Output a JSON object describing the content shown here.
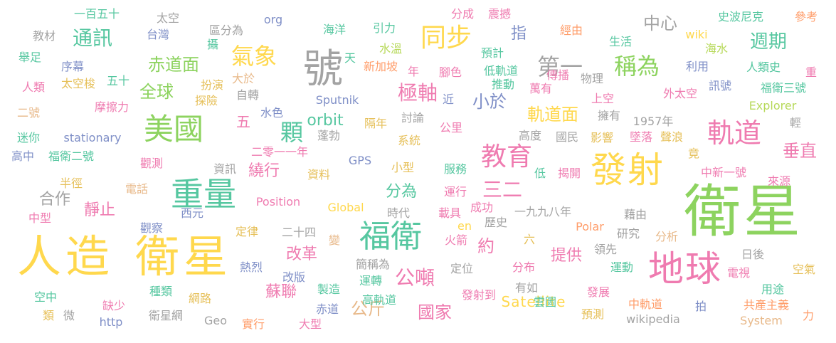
{
  "palette": {
    "yellow": "#ffd84d",
    "green": "#8dd35f",
    "teal": "#56c7a0",
    "pink": "#ef7bb0",
    "orange": "#ff9d6a",
    "gold": "#e6c05a",
    "gray": "#a3a3a3",
    "blue": "#7f8fc7",
    "tan": "#e8b98a",
    "lime": "#b7d95a"
  },
  "words": [
    {
      "text": "衛星",
      "color": "green"
    },
    {
      "text": "人造",
      "color": "yellow"
    },
    {
      "text": "衛星",
      "color": "yellow"
    },
    {
      "text": "地球",
      "color": "pink"
    },
    {
      "text": "發射",
      "color": "yellow"
    },
    {
      "text": "號",
      "color": "gray"
    },
    {
      "text": "重量",
      "color": "teal"
    },
    {
      "text": "福衛",
      "color": "teal"
    },
    {
      "text": "美國",
      "color": "green"
    },
    {
      "text": "同步",
      "color": "yellow"
    },
    {
      "text": "教育",
      "color": "pink"
    },
    {
      "text": "軌道",
      "color": "pink"
    },
    {
      "text": "氣象",
      "color": "yellow"
    },
    {
      "text": "稱為",
      "color": "green"
    },
    {
      "text": "第一",
      "color": "gray"
    },
    {
      "text": "顆",
      "color": "teal"
    },
    {
      "text": "三二",
      "color": "pink"
    },
    {
      "text": "通訊",
      "color": "teal"
    },
    {
      "text": "極軸",
      "color": "pink"
    },
    {
      "text": "公噸",
      "color": "pink"
    },
    {
      "text": "週期",
      "color": "teal"
    },
    {
      "text": "赤道面",
      "color": "green"
    },
    {
      "text": "全球",
      "color": "green"
    },
    {
      "text": "軌道面",
      "color": "yellow"
    },
    {
      "text": "垂直",
      "color": "pink"
    },
    {
      "text": "小於",
      "color": "blue"
    },
    {
      "text": "約",
      "color": "pink"
    },
    {
      "text": "中心",
      "color": "gray"
    },
    {
      "text": "國家",
      "color": "pink"
    },
    {
      "text": "公斤",
      "color": "tan"
    },
    {
      "text": "蘇聯",
      "color": "pink"
    },
    {
      "text": "改革",
      "color": "pink"
    },
    {
      "text": "提供",
      "color": "pink"
    },
    {
      "text": "分為",
      "color": "teal"
    },
    {
      "text": "繞行",
      "color": "pink"
    },
    {
      "text": "靜止",
      "color": "pink"
    },
    {
      "text": "指",
      "color": "blue"
    },
    {
      "text": "五",
      "color": "pink"
    },
    {
      "text": "合作",
      "color": "gray"
    },
    {
      "text": "orbit",
      "color": "teal"
    },
    {
      "text": "Satellite",
      "color": "yellow"
    },
    {
      "text": "Explorer",
      "color": "lime"
    },
    {
      "text": "Sputnik",
      "color": "blue"
    },
    {
      "text": "stationary",
      "color": "blue"
    },
    {
      "text": "GPS",
      "color": "blue"
    },
    {
      "text": "Position",
      "color": "pink"
    },
    {
      "text": "Global",
      "color": "yellow"
    },
    {
      "text": "Polar",
      "color": "orange"
    },
    {
      "text": "en",
      "color": "yellow"
    },
    {
      "text": "org",
      "color": "blue"
    },
    {
      "text": "wiki",
      "color": "yellow"
    },
    {
      "text": "http",
      "color": "blue"
    },
    {
      "text": "Geo",
      "color": "gray"
    },
    {
      "text": "wikipedia",
      "color": "gray"
    },
    {
      "text": "System",
      "color": "tan"
    },
    {
      "text": "一百五十",
      "color": "teal"
    },
    {
      "text": "太空",
      "color": "gray"
    },
    {
      "text": "台灣",
      "color": "blue"
    },
    {
      "text": "區分為",
      "color": "gray"
    },
    {
      "text": "海洋",
      "color": "teal"
    },
    {
      "text": "引力",
      "color": "teal"
    },
    {
      "text": "分成",
      "color": "pink"
    },
    {
      "text": "震撼",
      "color": "pink"
    },
    {
      "text": "經由",
      "color": "orange"
    },
    {
      "text": "史波尼克",
      "color": "teal"
    },
    {
      "text": "參考",
      "color": "orange"
    },
    {
      "text": "教材",
      "color": "gray"
    },
    {
      "text": "攝",
      "color": "teal"
    },
    {
      "text": "水溫",
      "color": "lime"
    },
    {
      "text": "預計",
      "color": "teal"
    },
    {
      "text": "生活",
      "color": "teal"
    },
    {
      "text": "海水",
      "color": "lime"
    },
    {
      "text": "舉足",
      "color": "teal"
    },
    {
      "text": "序幕",
      "color": "blue"
    },
    {
      "text": "大於",
      "color": "tan"
    },
    {
      "text": "天",
      "color": "teal"
    },
    {
      "text": "新加坡",
      "color": "orange"
    },
    {
      "text": "年",
      "color": "pink"
    },
    {
      "text": "腳色",
      "color": "pink"
    },
    {
      "text": "低軌道",
      "color": "teal"
    },
    {
      "text": "傳播",
      "color": "pink"
    },
    {
      "text": "利用",
      "color": "blue"
    },
    {
      "text": "人類史",
      "color": "teal"
    },
    {
      "text": "重",
      "color": "pink"
    },
    {
      "text": "人類",
      "color": "pink"
    },
    {
      "text": "太空梭",
      "color": "gold"
    },
    {
      "text": "五十",
      "color": "teal"
    },
    {
      "text": "扮演",
      "color": "gold"
    },
    {
      "text": "推動",
      "color": "teal"
    },
    {
      "text": "萬有",
      "color": "pink"
    },
    {
      "text": "物理",
      "color": "gray"
    },
    {
      "text": "訊號",
      "color": "blue"
    },
    {
      "text": "福衛三號",
      "color": "teal"
    },
    {
      "text": "二號",
      "color": "tan"
    },
    {
      "text": "摩擦力",
      "color": "pink"
    },
    {
      "text": "探險",
      "color": "gold"
    },
    {
      "text": "自轉",
      "color": "gray"
    },
    {
      "text": "近",
      "color": "blue"
    },
    {
      "text": "上空",
      "color": "pink"
    },
    {
      "text": "外太空",
      "color": "pink"
    },
    {
      "text": "水色",
      "color": "blue"
    },
    {
      "text": "討論",
      "color": "gray"
    },
    {
      "text": "擁有",
      "color": "gray"
    },
    {
      "text": "1957年",
      "color": "gray"
    },
    {
      "text": "迷你",
      "color": "teal"
    },
    {
      "text": "蓬勃",
      "color": "gray"
    },
    {
      "text": "隔年",
      "color": "gold"
    },
    {
      "text": "公里",
      "color": "pink"
    },
    {
      "text": "高度",
      "color": "gray"
    },
    {
      "text": "國民",
      "color": "gray"
    },
    {
      "text": "影響",
      "color": "gold"
    },
    {
      "text": "墜落",
      "color": "pink"
    },
    {
      "text": "聲浪",
      "color": "gold"
    },
    {
      "text": "輕",
      "color": "gray"
    },
    {
      "text": "系統",
      "color": "gold"
    },
    {
      "text": "高中",
      "color": "blue"
    },
    {
      "text": "福衛二號",
      "color": "teal"
    },
    {
      "text": "二零一一年",
      "color": "pink"
    },
    {
      "text": "竟",
      "color": "gold"
    },
    {
      "text": "觀測",
      "color": "pink"
    },
    {
      "text": "資訊",
      "color": "gray"
    },
    {
      "text": "資料",
      "color": "gold"
    },
    {
      "text": "小型",
      "color": "gold"
    },
    {
      "text": "服務",
      "color": "teal"
    },
    {
      "text": "低",
      "color": "teal"
    },
    {
      "text": "揭開",
      "color": "pink"
    },
    {
      "text": "中新一號",
      "color": "pink"
    },
    {
      "text": "半徑",
      "color": "gold"
    },
    {
      "text": "來源",
      "color": "pink"
    },
    {
      "text": "電話",
      "color": "tan"
    },
    {
      "text": "運行",
      "color": "pink"
    },
    {
      "text": "成功",
      "color": "pink"
    },
    {
      "text": "一九九八年",
      "color": "gray"
    },
    {
      "text": "西元",
      "color": "blue"
    },
    {
      "text": "時代",
      "color": "gray"
    },
    {
      "text": "載具",
      "color": "pink"
    },
    {
      "text": "藉由",
      "color": "gray"
    },
    {
      "text": "中型",
      "color": "pink"
    },
    {
      "text": "觀察",
      "color": "blue"
    },
    {
      "text": "定律",
      "color": "gold"
    },
    {
      "text": "二十四",
      "color": "gray"
    },
    {
      "text": "歷史",
      "color": "gray"
    },
    {
      "text": "研究",
      "color": "gray"
    },
    {
      "text": "分析",
      "color": "tan"
    },
    {
      "text": "火箭",
      "color": "pink"
    },
    {
      "text": "變",
      "color": "tan"
    },
    {
      "text": "六",
      "color": "gold"
    },
    {
      "text": "領先",
      "color": "gray"
    },
    {
      "text": "日後",
      "color": "gray"
    },
    {
      "text": "熱烈",
      "color": "blue"
    },
    {
      "text": "簡稱為",
      "color": "gray"
    },
    {
      "text": "定位",
      "color": "gray"
    },
    {
      "text": "分布",
      "color": "pink"
    },
    {
      "text": "運動",
      "color": "teal"
    },
    {
      "text": "電視",
      "color": "pink"
    },
    {
      "text": "空氣",
      "color": "gold"
    },
    {
      "text": "改版",
      "color": "blue"
    },
    {
      "text": "種類",
      "color": "teal"
    },
    {
      "text": "製造",
      "color": "teal"
    },
    {
      "text": "運轉",
      "color": "teal"
    },
    {
      "text": "發射到",
      "color": "pink"
    },
    {
      "text": "有如",
      "color": "gray"
    },
    {
      "text": "發展",
      "color": "pink"
    },
    {
      "text": "用途",
      "color": "teal"
    },
    {
      "text": "空中",
      "color": "teal"
    },
    {
      "text": "網路",
      "color": "gold"
    },
    {
      "text": "高軌道",
      "color": "teal"
    },
    {
      "text": "中軌道",
      "color": "orange"
    },
    {
      "text": "拍",
      "color": "blue"
    },
    {
      "text": "共產主義",
      "color": "orange"
    },
    {
      "text": "缺少",
      "color": "pink"
    },
    {
      "text": "赤道",
      "color": "blue"
    },
    {
      "text": "雲圖",
      "color": "teal"
    },
    {
      "text": "類",
      "color": "gold"
    },
    {
      "text": "微",
      "color": "gray"
    },
    {
      "text": "衛星網",
      "color": "gray"
    },
    {
      "text": "實行",
      "color": "orange"
    },
    {
      "text": "大型",
      "color": "pink"
    },
    {
      "text": "預測",
      "color": "gold"
    },
    {
      "text": "力",
      "color": "orange"
    }
  ]
}
